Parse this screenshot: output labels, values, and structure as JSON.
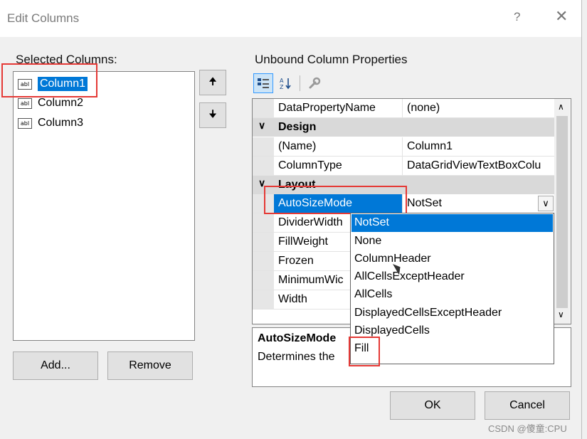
{
  "window": {
    "title": "Edit Columns",
    "help_glyph": "?",
    "close_glyph": "✕"
  },
  "selected_columns": {
    "label": "Selected Columns:",
    "items": [
      {
        "icon": "abl",
        "label": "Column1",
        "selected": true
      },
      {
        "icon": "abl",
        "label": "Column2",
        "selected": false
      },
      {
        "icon": "abl",
        "label": "Column3",
        "selected": false
      }
    ],
    "move_up_glyph": "🠉",
    "move_down_glyph": "🠋"
  },
  "buttons": {
    "add": "Add...",
    "remove": "Remove",
    "ok": "OK",
    "cancel": "Cancel"
  },
  "properties": {
    "label": "Unbound Column Properties",
    "toolbar": {
      "categorized_icon": "categorized-icon",
      "alphabetical_icon": "alphabetical-icon",
      "property_pages_icon": "wrench-icon"
    },
    "rows": {
      "datapropertyname": {
        "name": "DataPropertyName",
        "value": "(none)"
      },
      "design_category": "Design",
      "name": {
        "name": "(Name)",
        "value": "Column1"
      },
      "columntype": {
        "name": "ColumnType",
        "value": "DataGridViewTextBoxColu"
      },
      "layout_category": "Layout",
      "autosizemode": {
        "name": "AutoSizeMode",
        "value": "NotSet"
      },
      "dividerwidth": {
        "name": "DividerWidth"
      },
      "fillweight": {
        "name": "FillWeight"
      },
      "frozen": {
        "name": "Frozen"
      },
      "minimumwidth": {
        "name": "MinimumWic"
      },
      "width": {
        "name": "Width"
      }
    },
    "dropdown_options": [
      "NotSet",
      "None",
      "ColumnHeader",
      "AllCellsExceptHeader",
      "AllCells",
      "DisplayedCellsExceptHeader",
      "DisplayedCells",
      "Fill"
    ],
    "dropdown_selected": "NotSet",
    "description": {
      "title": "AutoSizeMode",
      "text": "Determines the"
    }
  },
  "watermark": "CSDN @傻童:CPU",
  "colors": {
    "selection": "#0078d7",
    "highlight_box": "#e53935",
    "category_bg": "#d9d9d9"
  }
}
